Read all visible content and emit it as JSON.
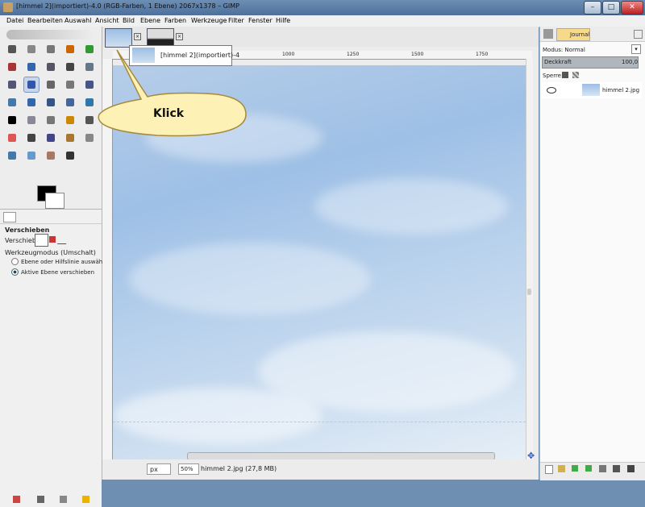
{
  "window": {
    "title": "[himmel 2](importiert)-4.0 (RGB-Farben, 1 Ebene) 2067x1378 – GIMP",
    "minimize": "–",
    "maximize": "□",
    "close": "✕"
  },
  "menu": [
    "Datei",
    "Bearbeiten",
    "Auswahl",
    "Ansicht",
    "Bild",
    "Ebene",
    "Farben",
    "Werkzeuge",
    "Filter",
    "Fenster",
    "Hilfe"
  ],
  "tool_options": {
    "title": "Verschieben",
    "move_label": "Verschieben:",
    "mode_label": "Werkzeugmodus (Umschalt)",
    "option1": "Ebene oder Hilfslinie auswählen",
    "option2": "Aktive Ebene verschieben"
  },
  "image_tabs": {
    "tooltip": "[himmel 2](importiert)-4"
  },
  "callout": {
    "text": "Klick"
  },
  "ruler": {
    "ticks": [
      "1000",
      "1250",
      "1500",
      "1750"
    ]
  },
  "status": {
    "unit": "px",
    "zoom": "50%",
    "info": "himmel 2.jpg (27,8 MB)"
  },
  "layers": {
    "tab_label": "Journal",
    "mode_label": "Modus: Normal",
    "opacity_label": "Deckkraft",
    "opacity_value": "100,0",
    "lock_label": "Sperre:",
    "layer_name": "himmel 2.jpg"
  }
}
